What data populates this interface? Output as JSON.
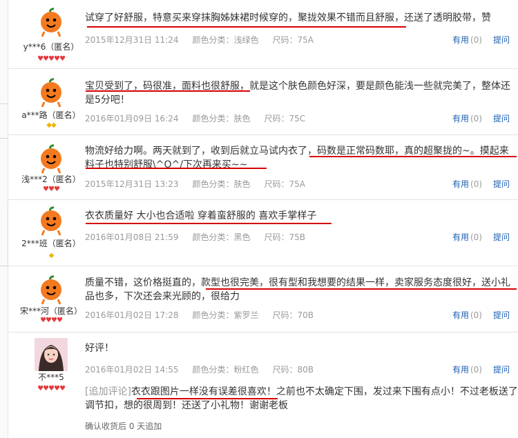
{
  "reviews": [
    {
      "user": "y***6（匿名）",
      "text": "试穿了好舒服，特意买来穿抹胸姊妹裙时候穿的，聚拢效果不错而且舒服，还送了透明胶带，赞",
      "date": "2015年12月31日 11:24",
      "color": "颜色分类：浅绿色",
      "size": "尺码：75A",
      "useful": "有用",
      "useful_count": "(0)",
      "ask": "提问",
      "badge_type": "heart",
      "badge_count": 5
    },
    {
      "user": "a***路（匿名）",
      "text": "宝贝受到了，码很准，面料也很舒服，就是这个肤色颜色好深，要是颜色能浅一些就完美了，整体还是5分吧！",
      "date": "2016年01月09日 16:24",
      "color": "颜色分类：肤色",
      "size": "尺码：75C",
      "useful": "有用",
      "useful_count": "(0)",
      "ask": "提问",
      "badge_type": "diamond",
      "badge_count": 2
    },
    {
      "user": "浅***2（匿名）",
      "text": "物流好给力啊。两天就到了，收到后就立马试内衣了，码数是正常码数耶，真的超聚拢的~。摸起来料子也特别舒服\\^O^/下次再来买~~",
      "date": "2015年12月31日 13:23",
      "color": "颜色分类：肤色",
      "size": "尺码：75A",
      "useful": "有用",
      "useful_count": "(0)",
      "ask": "提问",
      "badge_type": "heart",
      "badge_count": 3
    },
    {
      "user": "2***班（匿名）",
      "text": "衣衣质量好 大小也合适啦 穿着蛮舒服的 喜欢手掌样子",
      "date": "2016年01月08日 21:59",
      "color": "颜色分类：黑色",
      "size": "尺码：75B",
      "useful": "有用",
      "useful_count": "(0)",
      "ask": "提问",
      "badge_type": "diamond",
      "badge_count": 1
    },
    {
      "user": "宋***河（匿名）",
      "text": "质量不错，这价格挺直的，款型也很完美，很有型和我想要的结果一样，卖家服务态度很好，送小礼品也多，下次还会来光顾的，很给力",
      "date": "2016年01月02日 17:28",
      "color": "颜色分类：紫罗兰",
      "size": "尺码：70B",
      "useful": "有用",
      "useful_count": "(0)",
      "ask": "提问",
      "badge_type": "heart",
      "badge_count": 4
    },
    {
      "user": "不***5",
      "text": "好评！",
      "date": "2016年01月02日 14:55",
      "color": "颜色分类：粉红色",
      "size": "尺码：80B",
      "useful": "有用",
      "useful_count": "(0)",
      "ask": "提问",
      "badge_type": "heart",
      "badge_count": 5,
      "append_tag": "[追加评论]",
      "append_text": "衣衣跟图片一样没有误差很喜欢！之前也不太确定下围，发过来下围有点小！不过老板送了调节扣，想的很周到！还送了小礼物！谢谢老板",
      "confirm": "确认收货后 0 天追加"
    }
  ],
  "colors": {
    "link": "#1a5fb4",
    "meta": "#999999",
    "underline": "#d40000",
    "heart": "#e4393c",
    "diamond": "#f1b400",
    "avatar": "#f47a1f"
  },
  "icons": {
    "avatar": "orange-mascot-icon",
    "heart_badge": "red-heart-icon",
    "diamond_badge": "yellow-diamond-icon"
  }
}
